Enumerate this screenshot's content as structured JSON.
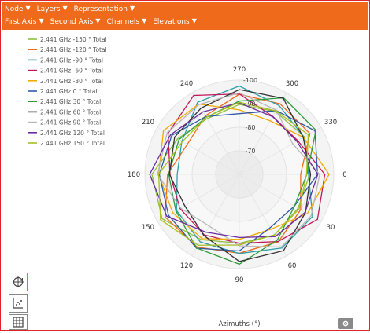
{
  "toolbar": {
    "row1": [
      {
        "label": "Node"
      },
      {
        "label": "Layers"
      },
      {
        "label": "Representation"
      }
    ],
    "row2": [
      {
        "label": "First Axis"
      },
      {
        "label": "Second Axis"
      },
      {
        "label": "Channels"
      },
      {
        "label": "Elevations"
      }
    ],
    "caret": "▼"
  },
  "chart_data": {
    "type": "polar-line",
    "xlabel": "Azimuths (°)",
    "angle_tick_labels": [
      0,
      30,
      60,
      90,
      120,
      150,
      180,
      210,
      240,
      270,
      300,
      330
    ],
    "radial_tick_labels": [
      -100,
      -90,
      -80,
      -70
    ],
    "rlim": [
      -100,
      -60
    ],
    "series": [
      {
        "name": "2.441 GHz -150 ° Total",
        "color": "#8fbf3f"
      },
      {
        "name": "2.441 GHz -120 ° Total",
        "color": "#ef6a1a"
      },
      {
        "name": "2.441 GHz -90 ° Total",
        "color": "#2e9fa8"
      },
      {
        "name": "2.441 GHz -60 ° Total",
        "color": "#c2185b"
      },
      {
        "name": "2.441 GHz -30 ° Total",
        "color": "#f2a900"
      },
      {
        "name": "2.441 GHz 0 ° Total",
        "color": "#2f5aa8"
      },
      {
        "name": "2.441 GHz 30 ° Total",
        "color": "#2e9b3a"
      },
      {
        "name": "2.441 GHz 60 ° Total",
        "color": "#333333"
      },
      {
        "name": "2.441 GHz 90 ° Total",
        "color": "#b8b8b8"
      },
      {
        "name": "2.441 GHz 120 ° Total",
        "color": "#6a2ca0"
      },
      {
        "name": "2.441 GHz 150 ° Total",
        "color": "#a8c020"
      }
    ]
  },
  "icons": {
    "rotate": "rotate-icon",
    "scatter": "scatter-icon",
    "table": "table-icon",
    "settings": "gear-icon"
  }
}
